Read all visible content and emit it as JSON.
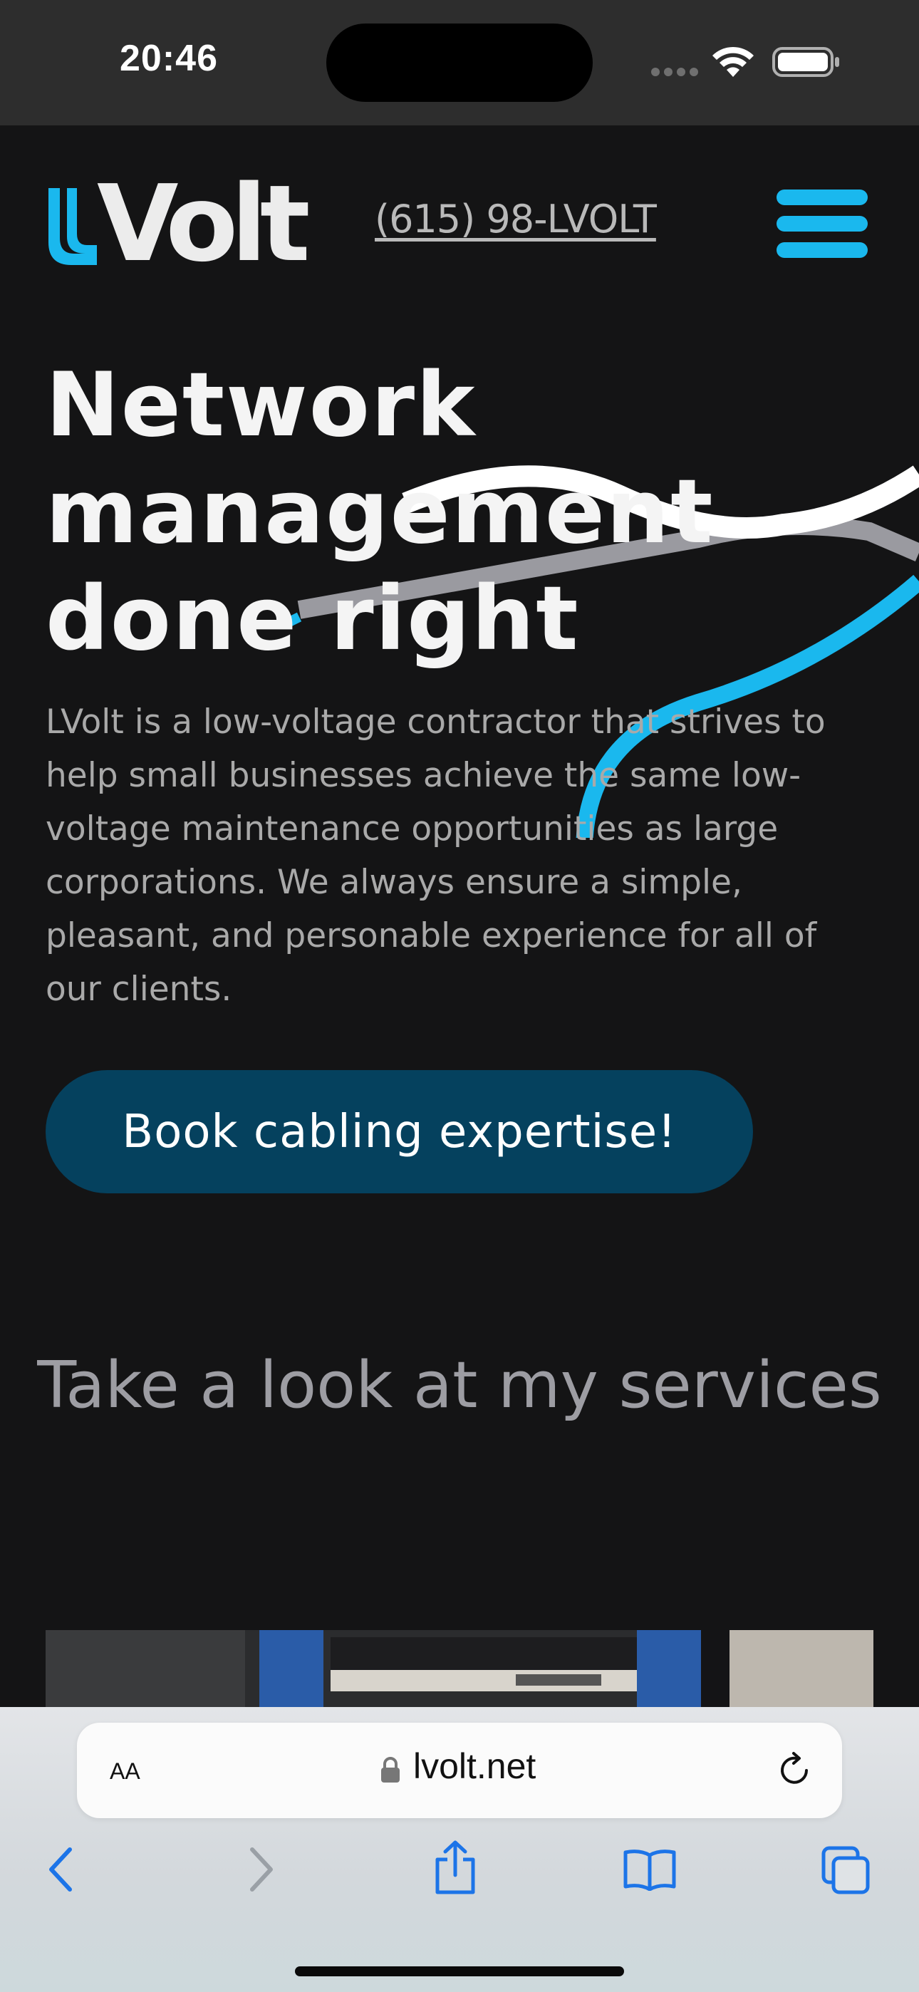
{
  "status_bar": {
    "time": "20:46"
  },
  "header": {
    "logo_text": "Volt",
    "phone": "(615) 98-LVOLT"
  },
  "hero": {
    "title_lines": [
      "Network",
      "management",
      "done right"
    ],
    "body": "LVolt is a low-voltage contractor that strives to help small businesses achieve the same low-voltage maintenance opportunities as large corporations. We always ensure a simple, pleasant, and personable experience for all of our clients.",
    "cta_label": "Book cabling expertise!"
  },
  "services": {
    "heading": "Take a look at my services"
  },
  "safari": {
    "aa_label": "AA",
    "url": "lvolt.net"
  },
  "colors": {
    "accent": "#1ab8ee",
    "cta_bg": "#05415e",
    "page_bg": "#141415",
    "body_text": "#a9a9a9"
  },
  "icons": {
    "menu": "hamburger-menu-icon",
    "wifi": "wifi-icon",
    "battery": "battery-icon",
    "lock": "lock-icon",
    "reload": "reload-icon",
    "back": "chevron-left-icon",
    "forward": "chevron-right-icon",
    "share": "share-icon",
    "bookmarks": "book-icon",
    "tabs": "tabs-icon"
  }
}
